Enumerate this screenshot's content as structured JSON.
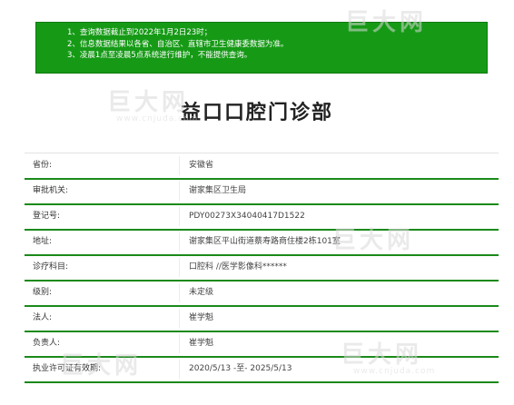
{
  "notice": {
    "lines": [
      "1、查询数据截止到2022年1月2日23时；",
      "2、信息数据结果以各省、自治区、直辖市卫生健康委数据为准。",
      "3、凌晨1点至凌晨5点系统进行维护，不能提供查询。"
    ]
  },
  "clinic": {
    "title": "益口口腔门诊部",
    "fields": [
      {
        "label": "省份:",
        "value": "安徽省"
      },
      {
        "label": "审批机关:",
        "value": "谢家集区卫生局"
      },
      {
        "label": "登记号:",
        "value": "PDY00273X34040417D1522"
      },
      {
        "label": "地址:",
        "value": "谢家集区平山街道蔡寿路商住楼2栋101室"
      },
      {
        "label": "诊疗科目:",
        "value": "口腔科 //医学影像科******"
      },
      {
        "label": "级别:",
        "value": "未定级"
      },
      {
        "label": "法人:",
        "value": "崔学魁"
      },
      {
        "label": "负责人:",
        "value": "崔学魁"
      },
      {
        "label": "执业许可证有效期:",
        "value": "2020/5/13 -至- 2025/5/13"
      }
    ]
  },
  "watermarks": {
    "logo_text": "巨大网",
    "url_text": "www.cnjuda.com"
  },
  "colors": {
    "notice_bg": "#169a16",
    "row_accent": "#1a8a1a"
  }
}
